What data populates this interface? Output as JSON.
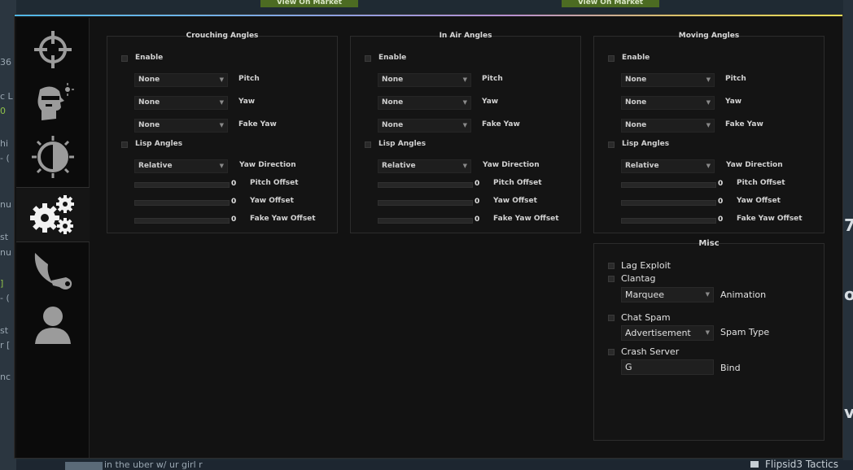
{
  "background": {
    "market_button_label": "View On Market",
    "left_fragments": [
      "36",
      "c L",
      "0",
      "hi",
      "- (",
      "nu",
      "st",
      "nu",
      "]",
      "- (",
      "st",
      "r [",
      "nc"
    ],
    "right_fragments": [
      "7",
      "o",
      "v"
    ],
    "bottom_text": "in the uber w/ ur girl r",
    "bottom_right_text": "Flipsid3 Tactics"
  },
  "sidebar": {
    "tabs": [
      {
        "name": "crosshair-icon"
      },
      {
        "name": "head-icon"
      },
      {
        "name": "contrast-sun-icon"
      },
      {
        "name": "gears-icon",
        "active": true
      },
      {
        "name": "karambit-knife-icon"
      },
      {
        "name": "user-icon"
      }
    ]
  },
  "groups": [
    {
      "title": "Crouching Angles",
      "enable": "Enable",
      "pitch": {
        "value": "None",
        "label": "Pitch"
      },
      "yaw": {
        "value": "None",
        "label": "Yaw"
      },
      "fake_yaw": {
        "value": "None",
        "label": "Fake Yaw"
      },
      "lisp": "Lisp Angles",
      "yaw_direction": {
        "value": "Relative",
        "label": "Yaw Direction"
      },
      "pitch_offset": {
        "value": "0",
        "label": "Pitch Offset"
      },
      "yaw_offset": {
        "value": "0",
        "label": "Yaw Offset"
      },
      "fake_yaw_offset": {
        "value": "0",
        "label": "Fake Yaw Offset"
      }
    },
    {
      "title": "In Air Angles",
      "enable": "Enable",
      "pitch": {
        "value": "None",
        "label": "Pitch"
      },
      "yaw": {
        "value": "None",
        "label": "Yaw"
      },
      "fake_yaw": {
        "value": "None",
        "label": "Fake Yaw"
      },
      "lisp": "Lisp Angles",
      "yaw_direction": {
        "value": "Relative",
        "label": "Yaw Direction"
      },
      "pitch_offset": {
        "value": "0",
        "label": "Pitch Offset"
      },
      "yaw_offset": {
        "value": "0",
        "label": "Yaw Offset"
      },
      "fake_yaw_offset": {
        "value": "0",
        "label": "Fake Yaw Offset"
      }
    },
    {
      "title": "Moving Angles",
      "enable": "Enable",
      "pitch": {
        "value": "None",
        "label": "Pitch"
      },
      "yaw": {
        "value": "None",
        "label": "Yaw"
      },
      "fake_yaw": {
        "value": "None",
        "label": "Fake Yaw"
      },
      "lisp": "Lisp Angles",
      "yaw_direction": {
        "value": "Relative",
        "label": "Yaw Direction"
      },
      "pitch_offset": {
        "value": "0",
        "label": "Pitch Offset"
      },
      "yaw_offset": {
        "value": "0",
        "label": "Yaw Offset"
      },
      "fake_yaw_offset": {
        "value": "0",
        "label": "Fake Yaw Offset"
      }
    }
  ],
  "misc": {
    "title": "Misc",
    "lag_exploit": "Lag Exploit",
    "clantag": "Clantag",
    "animation": {
      "value": "Marquee",
      "label": "Animation"
    },
    "chat_spam": "Chat Spam",
    "spam_type": {
      "value": "Advertisement",
      "label": "Spam Type"
    },
    "crash_server": "Crash Server",
    "bind": {
      "value": "G",
      "label": "Bind"
    }
  }
}
